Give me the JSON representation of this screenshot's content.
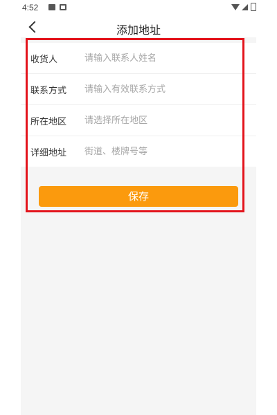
{
  "status_bar": {
    "time": "4:52"
  },
  "header": {
    "title": "添加地址"
  },
  "form": {
    "rows": [
      {
        "label": "收货人",
        "placeholder": "请输入联系人姓名",
        "value": ""
      },
      {
        "label": "联系方式",
        "placeholder": "请输入有效联系方式",
        "value": ""
      },
      {
        "label": "所在地区",
        "placeholder": "请选择所在地区",
        "value": ""
      },
      {
        "label": "详细地址",
        "placeholder": "街道、楼牌号等",
        "value": ""
      }
    ]
  },
  "save_button": {
    "label": "保存"
  },
  "colors": {
    "accent": "#fb9a0d",
    "highlight": "#e3141c",
    "background": "#f5f5f5"
  },
  "icons": [
    "back-chevron-icon",
    "wifi-icon",
    "signal-icon",
    "battery-icon"
  ]
}
